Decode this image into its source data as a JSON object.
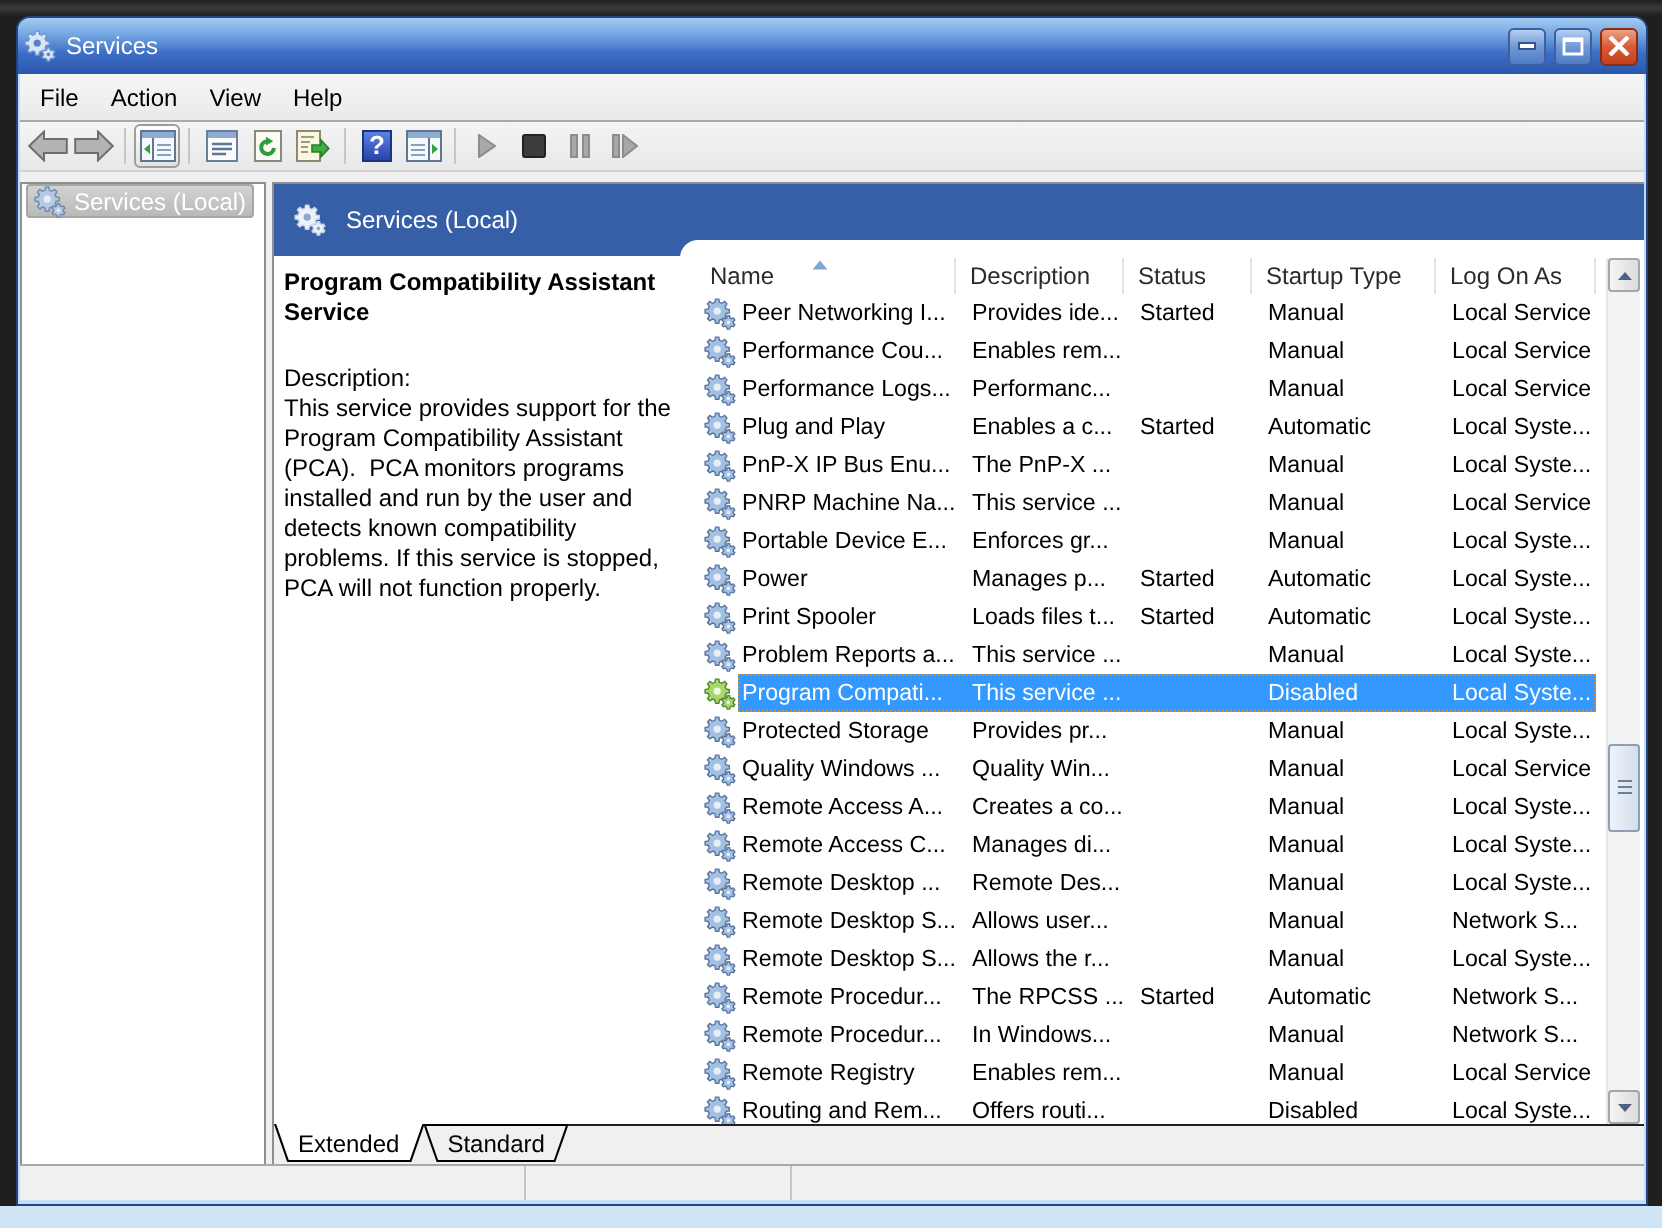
{
  "window": {
    "title": "Services"
  },
  "menu": [
    "File",
    "Action",
    "View",
    "Help"
  ],
  "toolbar": [
    {
      "buttons": [
        {
          "kind": "back",
          "disabled": true,
          "pressed": false
        },
        {
          "kind": "forward",
          "disabled": true,
          "pressed": false
        }
      ]
    },
    {
      "buttons": [
        {
          "kind": "tree_pane",
          "disabled": false,
          "pressed": true
        }
      ]
    },
    {
      "buttons": [
        {
          "kind": "properties",
          "disabled": false,
          "pressed": false
        },
        {
          "kind": "refresh",
          "disabled": false,
          "pressed": false
        },
        {
          "kind": "export",
          "disabled": false,
          "pressed": false
        }
      ]
    },
    {
      "buttons": [
        {
          "kind": "help",
          "glyph": "?",
          "disabled": false,
          "pressed": false
        },
        {
          "kind": "action_pane",
          "disabled": false,
          "pressed": false
        }
      ]
    },
    {
      "buttons": [
        {
          "kind": "start",
          "disabled": true,
          "pressed": false
        },
        {
          "kind": "stop",
          "disabled": false,
          "pressed": false
        },
        {
          "kind": "pause",
          "disabled": true,
          "pressed": false
        },
        {
          "kind": "restart",
          "disabled": true,
          "pressed": false
        }
      ]
    }
  ],
  "tree": {
    "items": [
      {
        "label": "Services (Local)",
        "selected": true
      }
    ]
  },
  "pane_header": {
    "title": "Services (Local)"
  },
  "details": {
    "title": "Program Compatibility Assistant Service",
    "description_label": "Description:",
    "description": "This service provides support for the Program Compatibility Assistant (PCA).  PCA monitors programs installed and run by the user and detects known compatibility problems. If this service is stopped, PCA will not function properly."
  },
  "table": {
    "columns": [
      {
        "label": "Name",
        "sorted": true
      },
      {
        "label": "Description",
        "sorted": false
      },
      {
        "label": "Status",
        "sorted": false
      },
      {
        "label": "Startup Type",
        "sorted": false
      },
      {
        "label": "Log On As",
        "sorted": false
      }
    ],
    "rows": [
      {
        "name": "Peer Networking I...",
        "description": "Provides ide...",
        "status": "Started",
        "startup_type": "Manual",
        "log_on_as": "Local Service",
        "selected": false
      },
      {
        "name": "Performance Cou...",
        "description": "Enables rem...",
        "startup_type": "Manual",
        "log_on_as": "Local Service",
        "selected": false
      },
      {
        "name": "Performance Logs...",
        "description": "Performanc...",
        "startup_type": "Manual",
        "log_on_as": "Local Service",
        "selected": false
      },
      {
        "name": "Plug and Play",
        "description": "Enables a c...",
        "status": "Started",
        "startup_type": "Automatic",
        "log_on_as": "Local Syste...",
        "selected": false
      },
      {
        "name": "PnP-X IP Bus Enu...",
        "description": "The PnP-X ...",
        "startup_type": "Manual",
        "log_on_as": "Local Syste...",
        "selected": false
      },
      {
        "name": "PNRP Machine Na...",
        "description": "This service ...",
        "startup_type": "Manual",
        "log_on_as": "Local Service",
        "selected": false
      },
      {
        "name": "Portable Device E...",
        "description": "Enforces gr...",
        "startup_type": "Manual",
        "log_on_as": "Local Syste...",
        "selected": false
      },
      {
        "name": "Power",
        "description": "Manages p...",
        "status": "Started",
        "startup_type": "Automatic",
        "log_on_as": "Local Syste...",
        "selected": false
      },
      {
        "name": "Print Spooler",
        "description": "Loads files t...",
        "status": "Started",
        "startup_type": "Automatic",
        "log_on_as": "Local Syste...",
        "selected": false
      },
      {
        "name": "Problem Reports a...",
        "description": "This service ...",
        "startup_type": "Manual",
        "log_on_as": "Local Syste...",
        "selected": false
      },
      {
        "name": "Program Compati...",
        "description": "This service ...",
        "startup_type": "Disabled",
        "log_on_as": "Local Syste...",
        "selected": true
      },
      {
        "name": "Protected Storage",
        "description": "Provides pr...",
        "startup_type": "Manual",
        "log_on_as": "Local Syste...",
        "selected": false
      },
      {
        "name": "Quality Windows ...",
        "description": "Quality Win...",
        "startup_type": "Manual",
        "log_on_as": "Local Service",
        "selected": false
      },
      {
        "name": "Remote Access A...",
        "description": "Creates a co...",
        "startup_type": "Manual",
        "log_on_as": "Local Syste...",
        "selected": false
      },
      {
        "name": "Remote Access C...",
        "description": "Manages di...",
        "startup_type": "Manual",
        "log_on_as": "Local Syste...",
        "selected": false
      },
      {
        "name": "Remote Desktop ...",
        "description": "Remote Des...",
        "startup_type": "Manual",
        "log_on_as": "Local Syste...",
        "selected": false
      },
      {
        "name": "Remote Desktop S...",
        "description": "Allows user...",
        "startup_type": "Manual",
        "log_on_as": "Network S...",
        "selected": false
      },
      {
        "name": "Remote Desktop S...",
        "description": "Allows the r...",
        "startup_type": "Manual",
        "log_on_as": "Local Syste...",
        "selected": false
      },
      {
        "name": "Remote Procedur...",
        "description": "The RPCSS ...",
        "status": "Started",
        "startup_type": "Automatic",
        "log_on_as": "Network S...",
        "selected": false
      },
      {
        "name": "Remote Procedur...",
        "description": "In Windows...",
        "startup_type": "Manual",
        "log_on_as": "Network S...",
        "selected": false
      },
      {
        "name": "Remote Registry",
        "description": "Enables rem...",
        "startup_type": "Manual",
        "log_on_as": "Local Service",
        "selected": false
      },
      {
        "name": "Routing and Rem...",
        "description": "Offers routi...",
        "startup_type": "Disabled",
        "log_on_as": "Local Syste...",
        "selected": false
      }
    ]
  },
  "view_tabs": [
    {
      "label": "Extended",
      "selected": true
    },
    {
      "label": "Standard",
      "selected": false
    }
  ]
}
